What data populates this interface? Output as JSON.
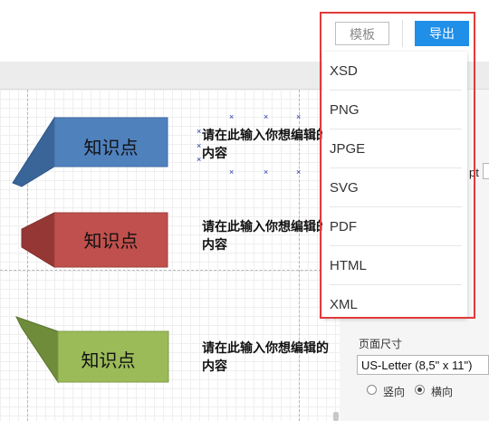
{
  "toolbar": {
    "template_label": "模板",
    "export_label": "导出"
  },
  "export_menu": {
    "items": [
      "XSD",
      "PNG",
      "JPGE",
      "SVG",
      "PDF",
      "HTML",
      "XML"
    ]
  },
  "canvas": {
    "shapes": [
      {
        "label": "知识点",
        "note": "请在此输入你想编辑的内容",
        "color": "#4f81bd"
      },
      {
        "label": "知识点",
        "note": "请在此输入你想编辑的内容",
        "color": "#c0504d"
      },
      {
        "label": "知识点",
        "note": "请在此输入你想编辑的内容",
        "color": "#9bbb59"
      }
    ]
  },
  "right_panel": {
    "unit_fragment": "pt",
    "page_size_label": "页面尺寸",
    "page_size_value": "US-Letter (8,5\" x 11\")",
    "orientation": {
      "portrait": "竖向",
      "landscape": "横向",
      "selected": "landscape"
    }
  },
  "colors": {
    "accent": "#1f8fe8",
    "highlight": "#e33a3a"
  }
}
